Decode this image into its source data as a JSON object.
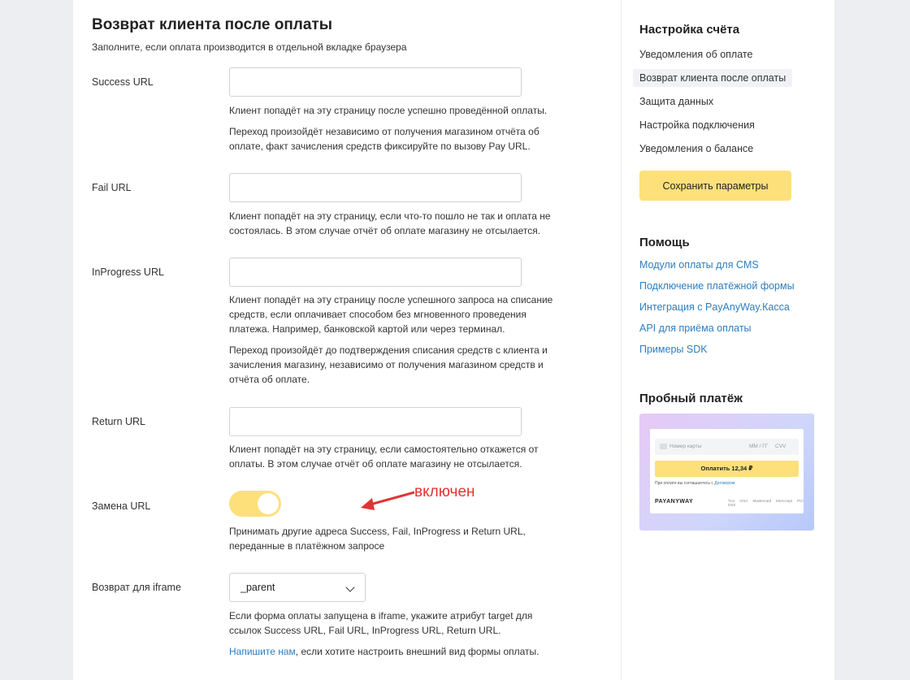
{
  "main": {
    "title": "Возврат клиента после оплаты",
    "subtitle": "Заполните, если оплата производится в отдельной вкладке браузера",
    "fields": [
      {
        "label": "Success URL",
        "value": "",
        "help": [
          "Клиент попадёт на эту страницу после успешно проведённой оплаты.",
          "Переход произойдёт независимо от получения магазином отчёта об",
          "оплате, факт зачисления средств фиксируйте по вызову Pay URL."
        ]
      },
      {
        "label": "Fail URL",
        "value": "",
        "help": [
          "Клиент попадёт на эту страницу, если что-то пошло не так и оплата не",
          "состоялась. В этом случае отчёт об оплате магазину не отсылается."
        ]
      },
      {
        "label": "InProgress URL",
        "value": "",
        "help": [
          "Клиент попадёт на эту страницу после успешного запроса на списание",
          "средств, если оплачивает способом без мгновенного проведения",
          "платежа. Например, банковской картой или через терминал.",
          "Переход произойдёт до подтверждения списания средств с клиента и",
          "зачисления магазину, независимо от получения магазином средств и",
          "отчёта об оплате."
        ]
      },
      {
        "label": "Return URL",
        "value": "",
        "help": [
          "Клиент попадёт на эту страницу, если самостоятельно откажется от",
          "оплаты. В этом случае отчёт об оплате магазину не отсылается."
        ]
      }
    ],
    "url_replace": {
      "label": "Замена URL",
      "enabled": true,
      "help": [
        "Принимать другие адреса Success, Fail, InProgress и Return URL,",
        "переданные в платёжном запросе"
      ],
      "annotation": "включен"
    },
    "iframe": {
      "label": "Возврат для iframe",
      "selected": "_parent",
      "help": [
        "Если форма оплаты запущена в iframe, укажите атрибут target для",
        "ссылок Success URL, Fail URL, InProgress URL, Return URL."
      ],
      "contact_link": "Напишите нам",
      "contact_rest": ", если хотите настроить внешний вид формы оплаты."
    }
  },
  "sidebar": {
    "settings_title": "Настройка счёта",
    "nav": [
      "Уведомления об оплате",
      "Возврат клиента после оплаты",
      "Защита данных",
      "Настройка подключения",
      "Уведомления о балансе"
    ],
    "active_index": 1,
    "save_label": "Сохранить параметры",
    "help_title": "Помощь",
    "help_links": [
      "Модули оплаты для CMS",
      "Подключение платёжной формы",
      "Интеграция с PayAnyWay.Касса",
      "API для приёма оплаты",
      "Примеры SDK"
    ],
    "trial_title": "Пробный платёж",
    "trial": {
      "card_placeholder": "Номер карты",
      "expiry_placeholder": "ММ / ГГ",
      "cvv_placeholder": "CVV",
      "pay_label": "Оплатить 12,34 ₽",
      "agree_text": "При оплате вы соглашаетесь с ",
      "agree_link": "Договором",
      "logo": "PAYANYWAY",
      "badges": [
        "TLS",
        "VISA",
        "Mastercard",
        "MirAccept",
        "PCI DSS"
      ]
    }
  },
  "colors": {
    "accent": "#fde07a",
    "link": "#2b7ec1",
    "annotation": "#e03434"
  }
}
